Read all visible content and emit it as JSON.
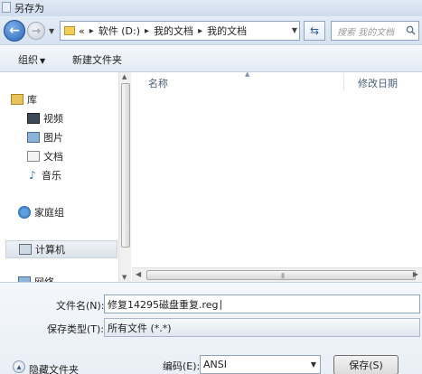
{
  "window": {
    "title": "另存为"
  },
  "address": {
    "prefix": "«",
    "crumbs": [
      "软件 (D:)",
      "我的文档",
      "我的文档"
    ]
  },
  "search": {
    "placeholder": "搜索 我的文档"
  },
  "toolbar": {
    "organize": "组织",
    "new_folder": "新建文件夹"
  },
  "sidebar": {
    "items": [
      {
        "label": "库",
        "icon": "library-icon"
      },
      {
        "label": "视频",
        "icon": "video-icon"
      },
      {
        "label": "图片",
        "icon": "pictures-icon"
      },
      {
        "label": "文档",
        "icon": "documents-icon"
      },
      {
        "label": "音乐",
        "icon": "music-icon"
      },
      {
        "label": "家庭组",
        "icon": "homegroup-icon"
      },
      {
        "label": "计算机",
        "icon": "computer-icon"
      },
      {
        "label": "网络",
        "icon": "network-icon"
      }
    ]
  },
  "list": {
    "columns": [
      "名称",
      "修改日期"
    ]
  },
  "form": {
    "filename_label": "文件名(N):",
    "filename_value": "修复14295磁盘重复.reg",
    "type_label": "保存类型(T):",
    "type_value": "所有文件 (*.*)",
    "encoding_label": "编码(E):",
    "encoding_value": "ANSI",
    "hide_folders": "隐藏文件夹",
    "save_button": "保存(S)"
  }
}
